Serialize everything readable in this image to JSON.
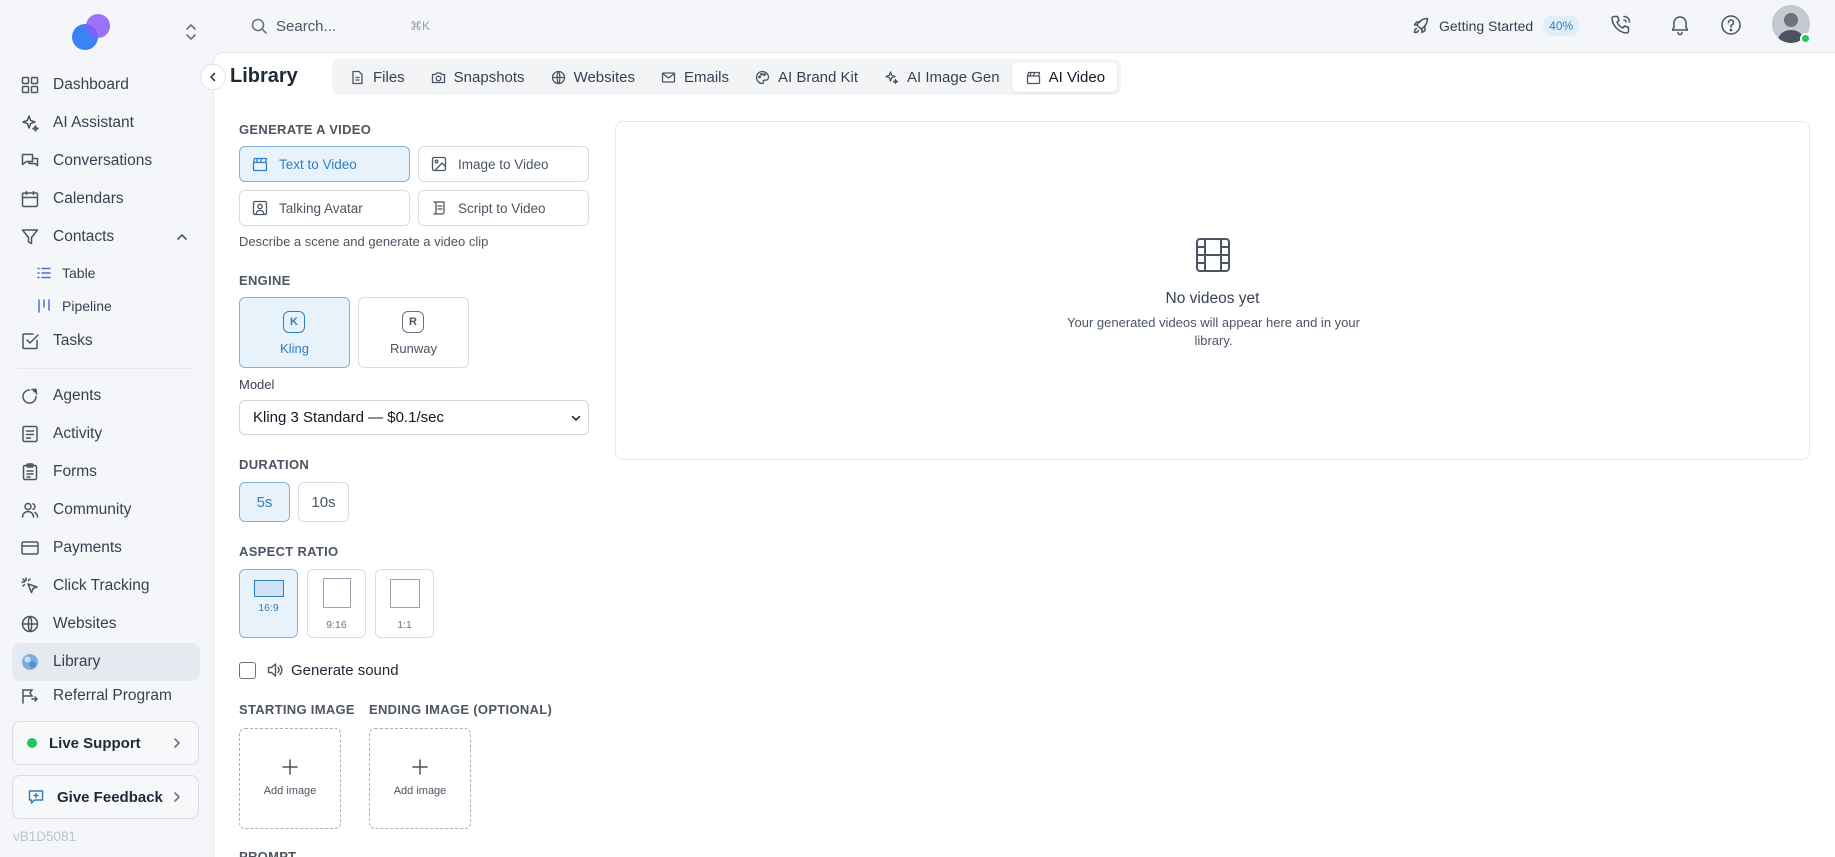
{
  "app": {
    "version": "vB1D5081",
    "accent_color": "#2f7fc1",
    "active_bg": "#e8f2fb"
  },
  "sidebar": {
    "items": [
      {
        "label": "Dashboard",
        "icon": "grid-icon"
      },
      {
        "label": "AI Assistant",
        "icon": "sparkles-icon"
      },
      {
        "label": "Conversations",
        "icon": "chat-bubbles-icon"
      },
      {
        "label": "Calendars",
        "icon": "calendar-icon"
      },
      {
        "label": "Contacts",
        "icon": "filter-icon",
        "expanded": true
      },
      {
        "label": "Table",
        "icon": "list-icon",
        "sub": true
      },
      {
        "label": "Pipeline",
        "icon": "pipeline-icon",
        "sub": true
      },
      {
        "label": "Tasks",
        "icon": "checkbox-icon"
      },
      {
        "label": "Agents",
        "icon": "agent-icon"
      },
      {
        "label": "Activity",
        "icon": "document-list-icon"
      },
      {
        "label": "Forms",
        "icon": "clipboard-icon"
      },
      {
        "label": "Community",
        "icon": "users-icon"
      },
      {
        "label": "Payments",
        "icon": "credit-card-icon"
      },
      {
        "label": "Click Tracking",
        "icon": "cursor-click-icon"
      },
      {
        "label": "Websites",
        "icon": "globe-icon"
      },
      {
        "label": "Library",
        "icon": "library-icon",
        "active": true
      },
      {
        "label": "Referral Program",
        "icon": "referral-icon"
      }
    ],
    "live_support_label": "Live Support",
    "feedback_label": "Give Feedback"
  },
  "topbar": {
    "search_placeholder": "Search...",
    "search_shortcut": "⌘K",
    "getting_started_label": "Getting Started",
    "getting_started_progress": "40%"
  },
  "page": {
    "title": "Library",
    "tabs": [
      {
        "label": "Files",
        "icon": "file-icon"
      },
      {
        "label": "Snapshots",
        "icon": "camera-icon"
      },
      {
        "label": "Websites",
        "icon": "globe-icon"
      },
      {
        "label": "Emails",
        "icon": "mail-icon"
      },
      {
        "label": "AI Brand Kit",
        "icon": "palette-icon"
      },
      {
        "label": "AI Image Gen",
        "icon": "sparkles-icon"
      },
      {
        "label": "AI Video",
        "icon": "clapperboard-icon",
        "active": true
      }
    ]
  },
  "form": {
    "generate_label": "GENERATE A VIDEO",
    "modes": [
      {
        "label": "Text to Video",
        "icon": "clapperboard-icon",
        "active": true
      },
      {
        "label": "Image to Video",
        "icon": "image-icon"
      },
      {
        "label": "Talking Avatar",
        "icon": "avatar-frame-icon"
      },
      {
        "label": "Script to Video",
        "icon": "script-icon"
      }
    ],
    "mode_hint": "Describe a scene and generate a video clip",
    "engine_label": "ENGINE",
    "engines": [
      {
        "badge": "K",
        "label": "Kling",
        "active": true
      },
      {
        "badge": "R",
        "label": "Runway"
      }
    ],
    "model_label": "Model",
    "model_value": "Kling 3 Standard — $0.1/sec",
    "duration_label": "DURATION",
    "durations": [
      {
        "label": "5s",
        "active": true
      },
      {
        "label": "10s"
      }
    ],
    "aspect_label": "ASPECT RATIO",
    "aspects": [
      {
        "label": "16:9",
        "active": true
      },
      {
        "label": "9:16"
      },
      {
        "label": "1:1"
      }
    ],
    "sound_label": "Generate sound",
    "sound_checked": false,
    "starting_image_label": "STARTING IMAGE",
    "ending_image_label": "ENDING IMAGE (OPTIONAL)",
    "add_image_label": "Add image",
    "prompt_label": "PROMPT"
  },
  "preview": {
    "empty_title": "No videos yet",
    "empty_desc": "Your generated videos will appear here and in your library."
  }
}
